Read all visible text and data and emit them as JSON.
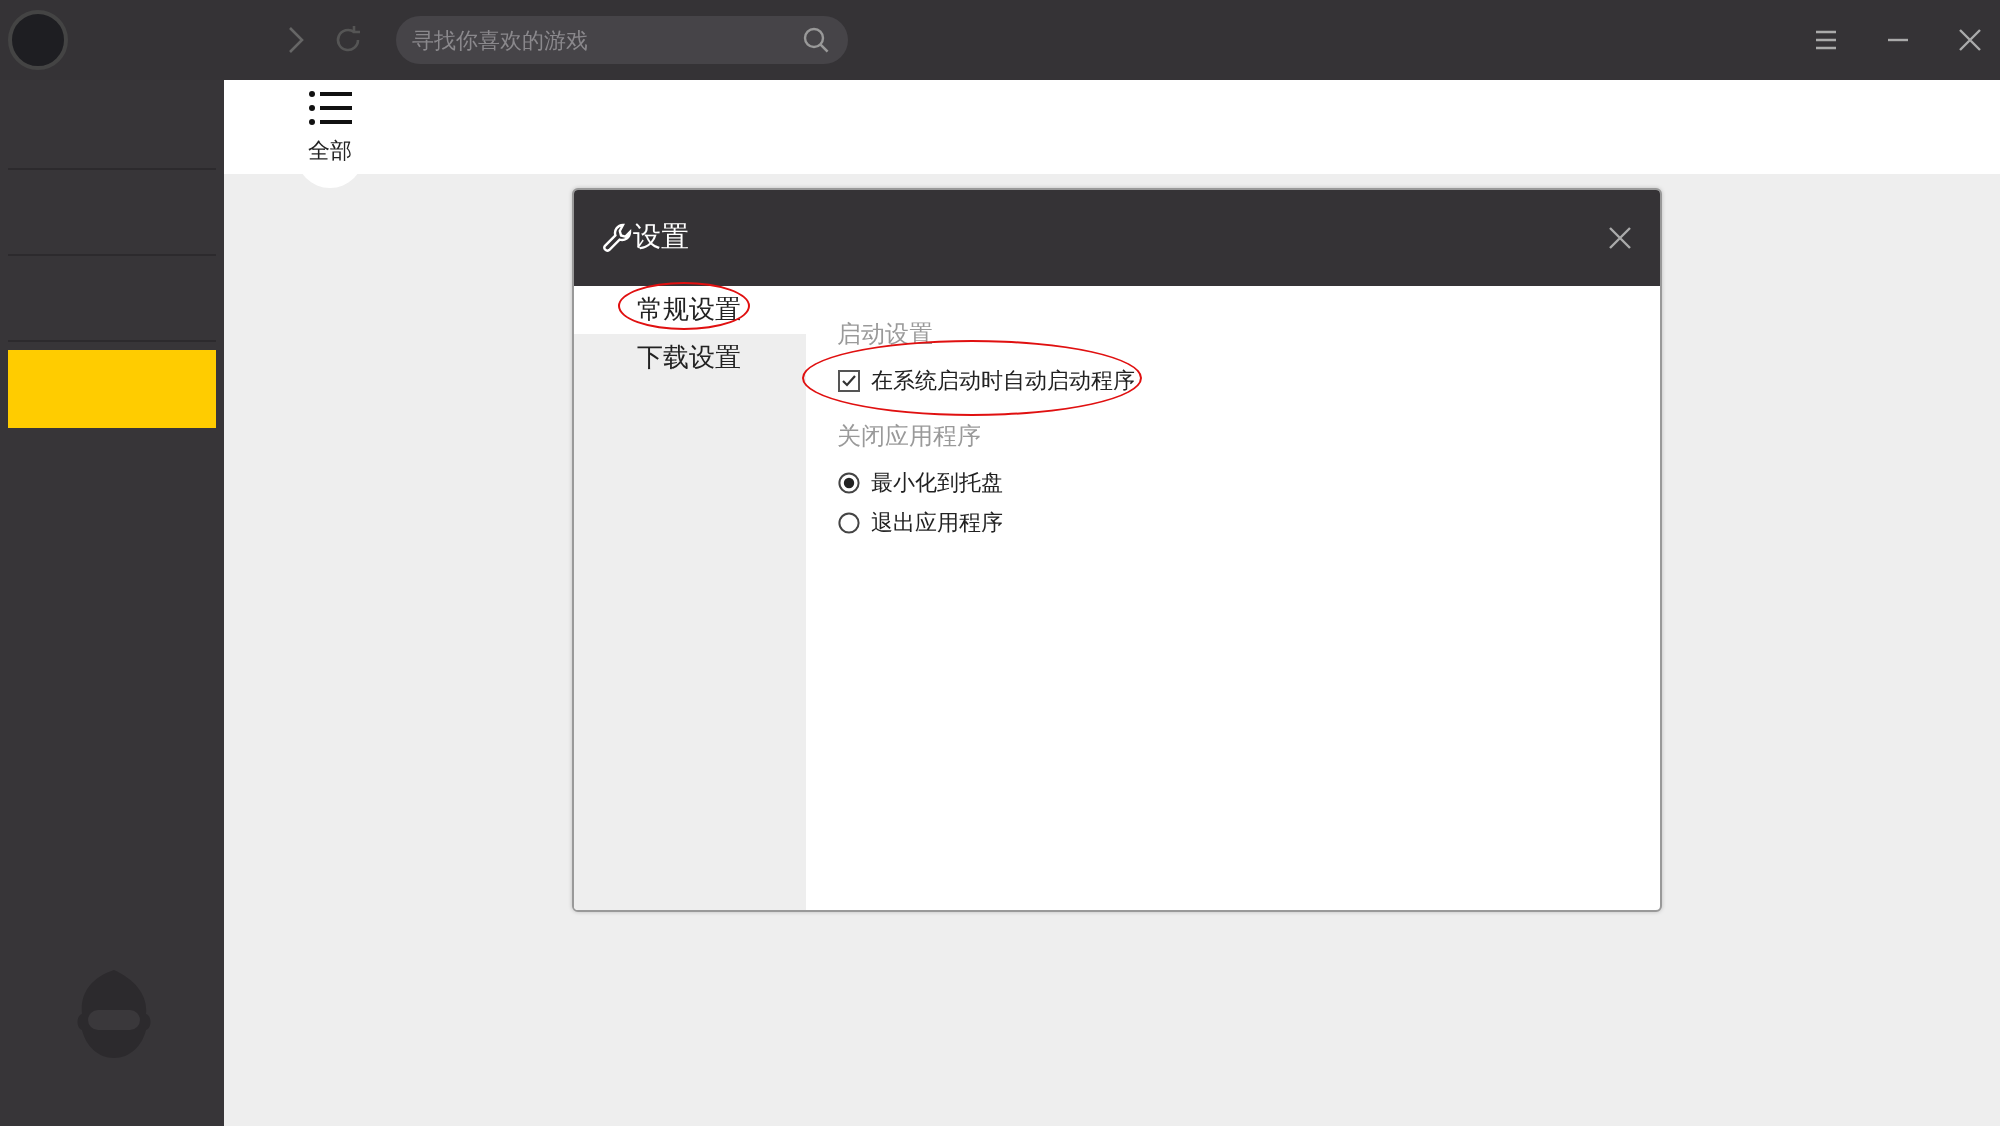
{
  "search": {
    "placeholder": "寻找你喜欢的游戏"
  },
  "sidebar": {
    "items": [
      {
        "selected": false
      },
      {
        "selected": false
      },
      {
        "selected": false
      },
      {
        "selected": true
      }
    ]
  },
  "category_tab": {
    "label": "全部",
    "selected": true
  },
  "dialog": {
    "title": "设置",
    "nav": [
      {
        "label": "常规设置",
        "selected": true,
        "circled": true
      },
      {
        "label": "下载设置",
        "selected": false,
        "circled": false
      }
    ],
    "sections": [
      {
        "heading": "启动设置",
        "options": [
          {
            "kind": "checkbox",
            "label": "在系统启动时自动启动程序",
            "checked": true,
            "circled": true
          }
        ]
      },
      {
        "heading": "关闭应用程序",
        "options": [
          {
            "kind": "radio",
            "label": "最小化到托盘",
            "selected": true,
            "circled": false
          },
          {
            "kind": "radio",
            "label": "退出应用程序",
            "selected": false,
            "circled": false
          }
        ]
      }
    ]
  }
}
